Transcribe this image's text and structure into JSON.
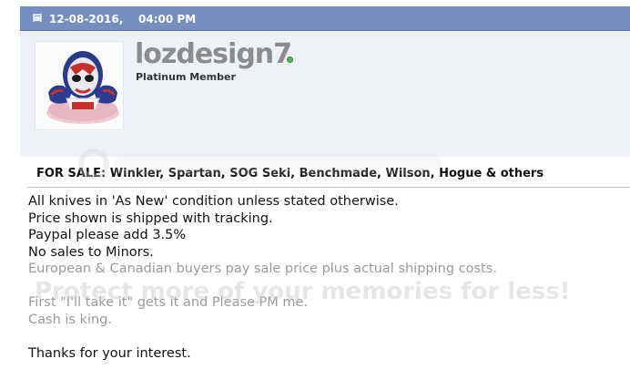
{
  "post": {
    "date": "12-08-2016,",
    "time": "04:00 PM",
    "author": {
      "username": "lozdesign7",
      "title": "Platinum Member",
      "online": true
    },
    "title": "FOR SALE: Winkler, Spartan, SOG Seki, Benchmade, Wilson, Hogue & others",
    "message_lines": [
      "All knives in 'As New' condition unless stated otherwise.",
      "Price shown is shipped with tracking.",
      "Paypal please add 3.5%",
      "No sales to Minors.",
      "European & Canadian buyers pay sale price plus actual shipping costs.",
      "",
      "First \"I'll take it\" gets it and Please PM me.",
      "Cash is king.",
      "",
      "Thanks for your interest."
    ],
    "watermark_text": "Protect more of your memories for less!"
  },
  "colors": {
    "header_bar": "#738fbf",
    "userinfo_bg": "#eef2f7",
    "online": "#57b55a"
  }
}
